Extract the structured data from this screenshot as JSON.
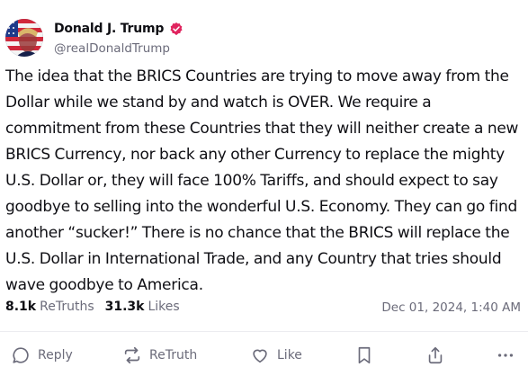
{
  "author": {
    "display_name": "Donald J. Trump",
    "handle": "@realDonaldTrump",
    "verified": true,
    "avatar_icon": "avatar-portrait-flag"
  },
  "post": {
    "text": "The idea that the BRICS Countries are trying to move away from the Dollar while we stand by and watch is OVER. We require a commitment from these Countries that they will neither create a new BRICS Currency, nor back any other Currency to replace the mighty U.S. Dollar or, they will face 100% Tariffs, and should expect to say goodbye to selling into the wonderful U.S. Economy. They can go find another “sucker!” There is no chance that the BRICS will replace the U.S. Dollar in International Trade, and any Country that tries should wave goodbye to America.",
    "retruths_count": "8.1k",
    "retruths_label": "ReTruths",
    "likes_count": "31.3k",
    "likes_label": "Likes",
    "timestamp": "Dec 01, 2024, 1:40 AM"
  },
  "actions": {
    "reply_label": "Reply",
    "retruth_label": "ReTruth",
    "like_label": "Like",
    "icons": [
      "reply-icon",
      "retruth-icon",
      "like-icon",
      "bookmark-icon",
      "share-icon",
      "more-icon"
    ]
  },
  "colors": {
    "text": "#0f0f14",
    "muted": "#6b6b7a",
    "verified": "#e0245e",
    "divider": "#ececf0"
  }
}
